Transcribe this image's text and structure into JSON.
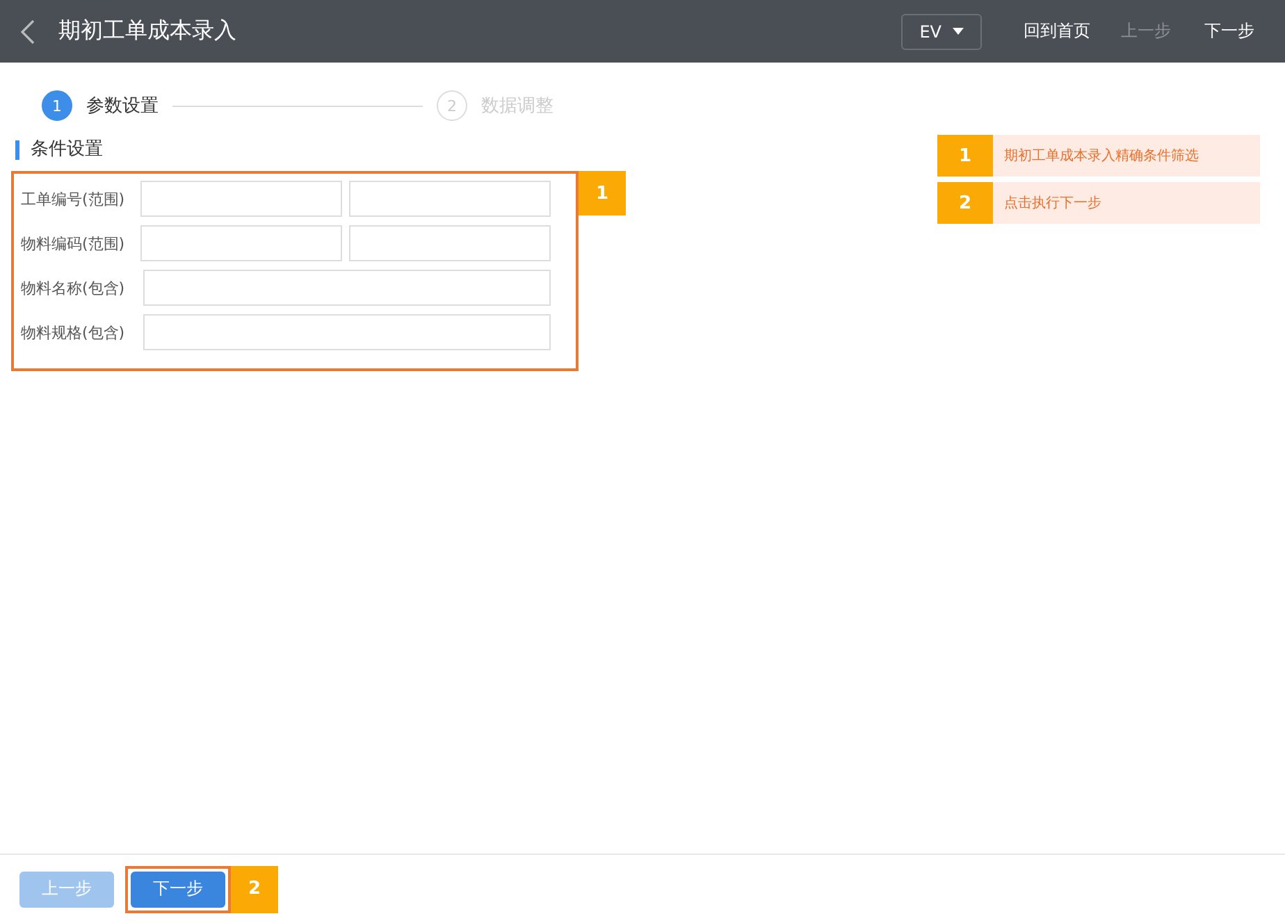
{
  "header": {
    "title": "期初工单成本录入",
    "language": "EV",
    "nav": [
      {
        "label": "回到首页",
        "disabled": false
      },
      {
        "label": "上一步",
        "disabled": true
      },
      {
        "label": "下一步",
        "disabled": false
      }
    ]
  },
  "steps": [
    {
      "number": "1",
      "label": "参数设置",
      "selected": true
    },
    {
      "number": "2",
      "label": "数据调整",
      "selected": false
    }
  ],
  "section": {
    "title": "条件设置",
    "marker": "1",
    "fields": [
      {
        "label": "工单编号(范围)",
        "kind": "range"
      },
      {
        "label": "物料编码(范围)",
        "kind": "range"
      },
      {
        "label": "物料名称(包含)",
        "kind": "single"
      },
      {
        "label": "物料规格(包含)",
        "kind": "single"
      }
    ]
  },
  "notes": [
    {
      "number": "1",
      "text": "期初工单成本录入精确条件筛选"
    },
    {
      "number": "2",
      "text": "点击执行下一步"
    }
  ],
  "footer": {
    "marker": "2",
    "buttons": [
      {
        "label": "上一步",
        "disabled": true,
        "highlighted": false
      },
      {
        "label": "下一步",
        "disabled": false,
        "highlighted": true
      }
    ]
  }
}
